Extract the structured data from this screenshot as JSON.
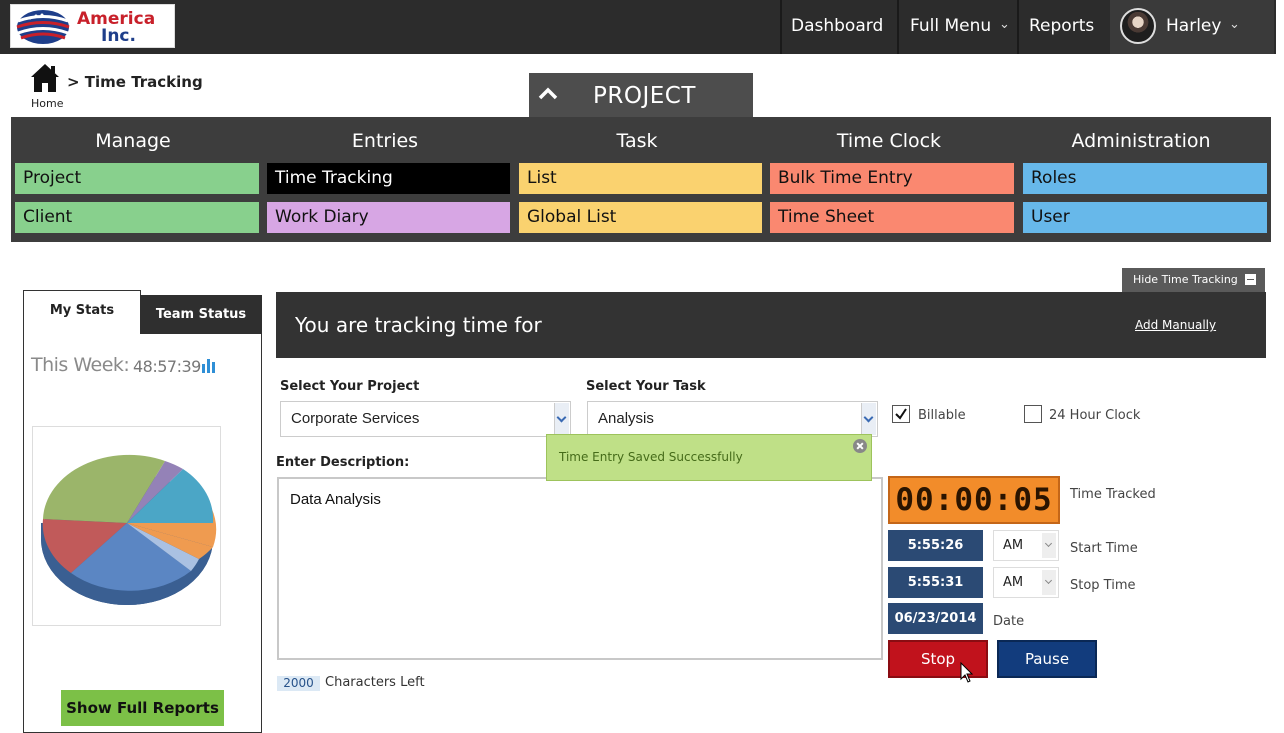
{
  "brand": {
    "line1": "America",
    "line2": "Inc."
  },
  "nav": {
    "dashboard": "Dashboard",
    "full_menu": "Full Menu",
    "reports": "Reports",
    "user": "Harley"
  },
  "breadcrumb": {
    "home": "Home",
    "current": "> Time Tracking"
  },
  "project_tab": "PROJECT",
  "menu": {
    "columns": [
      {
        "heading": "Manage",
        "items": [
          "Project",
          "Client"
        ],
        "color": "#88d08d"
      },
      {
        "heading": "Entries",
        "items": [
          "Time Tracking",
          "Work Diary"
        ],
        "colors": [
          "#000000",
          "#d7a6e4"
        ]
      },
      {
        "heading": "Task",
        "items": [
          "List",
          "Global List"
        ],
        "color": "#fad26f"
      },
      {
        "heading": "Time Clock",
        "items": [
          "Bulk Time Entry",
          "Time Sheet"
        ],
        "color": "#fa8870"
      },
      {
        "heading": "Administration",
        "items": [
          "Roles",
          "User"
        ],
        "color": "#67b8ea"
      }
    ]
  },
  "hide_tracking": "Hide Time Tracking",
  "stats": {
    "tab_my": "My Stats",
    "tab_team": "Team Status",
    "week_label": "This Week:",
    "week_value": "48:57:39",
    "full_reports": "Show Full Reports",
    "pie_colors": [
      "#5b86c3",
      "#c15a5a",
      "#9bb56a",
      "#9482b7",
      "#4ba6c6",
      "#ef9b50",
      "#aac1e2"
    ]
  },
  "tracker": {
    "title": "You are tracking time for",
    "add_manually": "Add Manually",
    "project_label": "Select Your Project",
    "project_value": "Corporate Services",
    "task_label": "Select Your Task",
    "task_value": "Analysis",
    "billable_label": "Billable",
    "billable_checked": true,
    "clock24_label": "24 Hour Clock",
    "clock24_checked": false,
    "toast": "Time Entry Saved Successfully",
    "description_label": "Enter Description:",
    "description_value": "Data Analysis",
    "chars_left_count": "2000",
    "chars_left_label": "Characters Left",
    "timer": "00:00:05",
    "time_tracked_label": "Time Tracked",
    "start_time": "5:55:26",
    "start_ampm": "AM",
    "start_label": "Start Time",
    "stop_time": "5:55:31",
    "stop_ampm": "AM",
    "stop_label": "Stop Time",
    "date": "06/23/2014",
    "date_label": "Date",
    "stop_button": "Stop",
    "pause_button": "Pause"
  }
}
